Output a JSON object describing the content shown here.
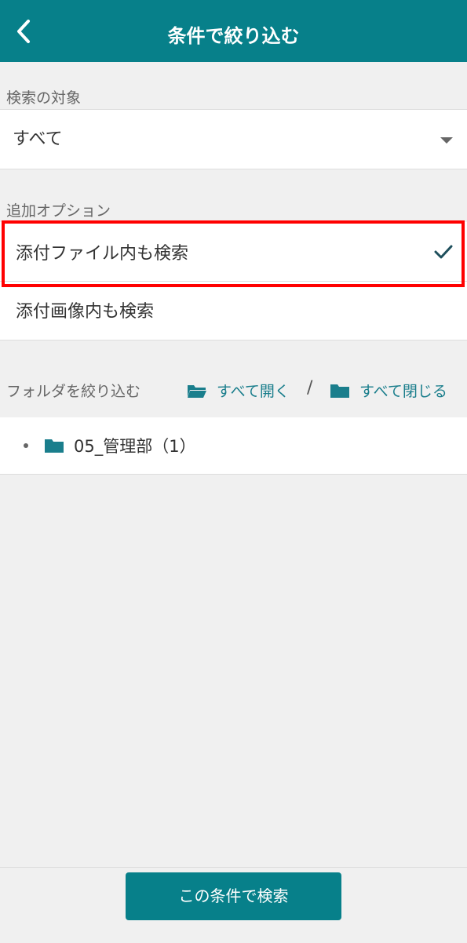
{
  "header": {
    "title": "条件で絞り込む",
    "back_icon": "chevron-left-icon"
  },
  "search_target": {
    "label": "検索の対象",
    "selected": "すべて",
    "arrow_icon": "caret-down-icon"
  },
  "options": {
    "label": "追加オプション",
    "items": [
      {
        "label": "添付ファイル内も検索",
        "checked": true
      },
      {
        "label": "添付画像内も検索",
        "checked": false
      }
    ]
  },
  "folders": {
    "label": "フォルダを絞り込む",
    "expand_all": "すべて開く",
    "separator": "/",
    "collapse_all": "すべて閉じる",
    "tree": [
      {
        "label": "05_管理部（1）"
      }
    ]
  },
  "footer": {
    "search_button": "この条件で検索"
  },
  "colors": {
    "primary": "#07808a",
    "link": "#1a7e8c",
    "highlight": "#ff0000",
    "background": "#f0f0f0"
  }
}
